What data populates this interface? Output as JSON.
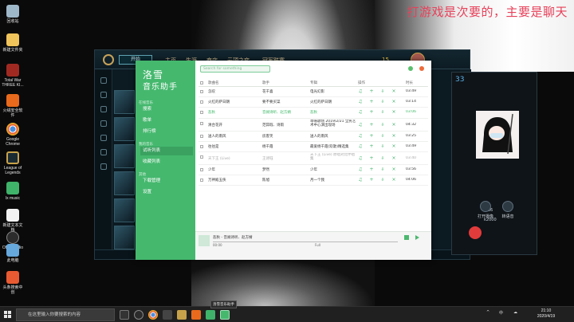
{
  "desktop": {
    "overlay_text": "打游戏是次要的，主要是聊天",
    "icons": [
      {
        "label": "回收站",
        "icon": "recycle-bin-icon",
        "color": "#9fb8c9"
      },
      {
        "label": "新建文件夹",
        "icon": "folder-icon",
        "color": "#f0c45a"
      },
      {
        "label": "Total War THREE KI...",
        "icon": "total-war-icon",
        "color": "#a02a22"
      },
      {
        "label": "火绒安全软件",
        "icon": "huorong-icon",
        "color": "#e96a1c"
      },
      {
        "label": "Google Chrome",
        "icon": "chrome-icon",
        "color": "#4aa365"
      },
      {
        "label": "League of Legends",
        "icon": "league-icon",
        "color": "#c8a24a"
      },
      {
        "label": "lx music",
        "icon": "lx-music-icon",
        "color": "#3fb36a"
      },
      {
        "label": "新建文本文档",
        "icon": "text-document-icon",
        "color": "#f2f2f2"
      },
      {
        "label": "OBS Studio",
        "icon": "obs-icon",
        "color": "#2c2c2c"
      },
      {
        "label": "此电脑",
        "icon": "this-pc-icon",
        "color": "#66a9dd"
      },
      {
        "label": "头条搜索中创",
        "icon": "toutiao-icon",
        "color": "#e85a32"
      }
    ]
  },
  "lol": {
    "play_label": "开始",
    "nav": [
      "主页",
      "生涯",
      "商店",
      "云顶之弈",
      "冠军联赛"
    ],
    "currency": "15",
    "chat_number": "33"
  },
  "chat": {
    "btn_mute": "打开摄像",
    "btn_camera": "转语音",
    "time": "0:56",
    "contact": "k2000"
  },
  "music": {
    "brand_line1": "洛雪",
    "brand_line2": "音乐助手",
    "search_placeholder": "Search for something",
    "nav_groups": [
      {
        "group": "在线音乐",
        "items": [
          "搜索",
          "歌单",
          "排行榜"
        ]
      },
      {
        "group": "我的音乐",
        "items": [
          "试听列表",
          "收藏列表"
        ]
      },
      {
        "group": "其他",
        "items": [
          "下载管理",
          "设置"
        ]
      }
    ],
    "active_nav": "试听列表",
    "columns": [
      "歌曲名",
      "歌手",
      "专辑",
      "操作",
      "时长"
    ],
    "songs": [
      {
        "title": "怎叹",
        "singer": "花千喜",
        "album": "电光幻影",
        "duration": "03:49",
        "state": "normal"
      },
      {
        "title": "火红的萨日朗",
        "singer": "要不要买菜",
        "album": "火红的萨日朗",
        "duration": "03:14",
        "state": "normal"
      },
      {
        "title": "悲秋",
        "singer": "音阙诗听、赵方婧",
        "album": "悲秋",
        "duration": "03:06",
        "state": "playing"
      },
      {
        "title": "清合花开",
        "singer": "范茹瑕、诗雨",
        "album": "草帽歌场 2019/2/21 全民艺术中心演出现场",
        "duration": "04:32",
        "state": "tall"
      },
      {
        "title": "送人的南风",
        "singer": "房客笑",
        "album": "送人的南风",
        "duration": "03:25",
        "state": "normal"
      },
      {
        "title": "往往是",
        "singer": "杨千霞",
        "album": "最爱杨千霞(欢歌)精选集",
        "duration": "03:49",
        "state": "normal"
      },
      {
        "title": "天下王 (Live)",
        "singer": "王诗钰",
        "album": "天下王 (Live) 原唱对比伴唱集",
        "duration": "03:40",
        "state": "grey"
      },
      {
        "title": "少年",
        "singer": "梦然",
        "album": "少年",
        "duration": "03:56",
        "state": "normal"
      },
      {
        "title": "万神殿五侠",
        "singer": "陈旭",
        "album": "月一个我",
        "duration": "04:06",
        "state": "normal"
      }
    ],
    "player": {
      "track": "悲秋 - 音阙诗听、赵方婧",
      "time_current": "00:00",
      "status": "Full"
    }
  },
  "taskbar": {
    "search_placeholder": "在这里输入你要搜索的内容",
    "tooltip": "洛雪音乐助手",
    "tray_items": [
      "^",
      "中",
      "☁"
    ],
    "time": "21:10",
    "date": "2020/4/19"
  },
  "colors": {
    "accent": "#45b86e",
    "playing": "#3db866",
    "overlay_text": "#e7415a"
  }
}
